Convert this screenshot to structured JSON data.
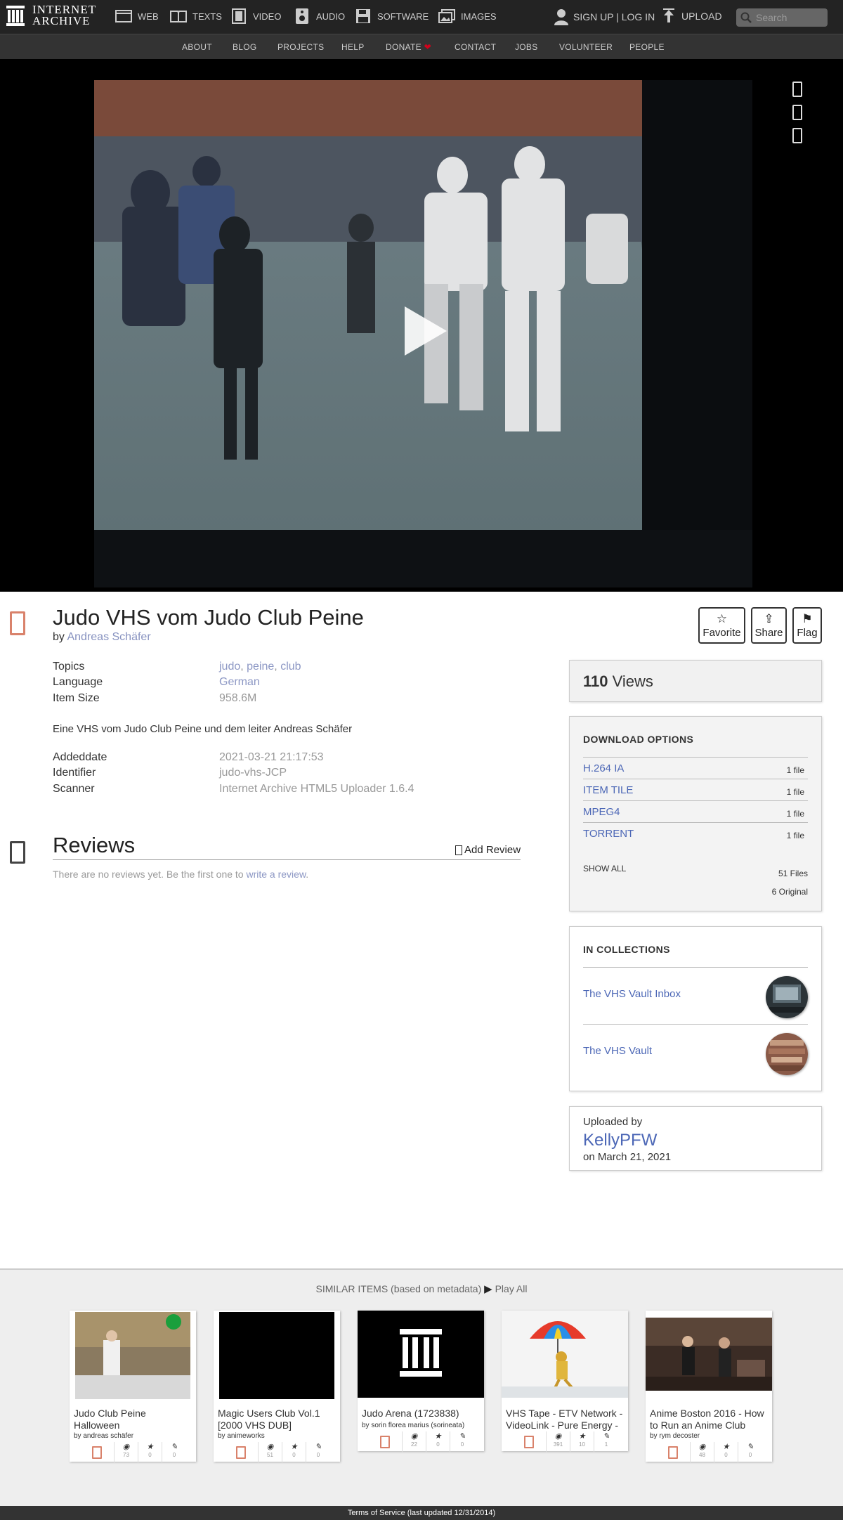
{
  "topnav": {
    "logo_line1": "INTERNET",
    "logo_line2": "ARCHIVE",
    "media": [
      {
        "label": "WEB",
        "icon": "web-icon"
      },
      {
        "label": "TEXTS",
        "icon": "book-icon"
      },
      {
        "label": "VIDEO",
        "icon": "film-icon"
      },
      {
        "label": "AUDIO",
        "icon": "speaker-icon"
      },
      {
        "label": "SOFTWARE",
        "icon": "floppy-icon"
      },
      {
        "label": "IMAGES",
        "icon": "image-icon"
      }
    ],
    "signup": "SIGN UP | LOG IN",
    "upload": "UPLOAD",
    "search_placeholder": "Search"
  },
  "subnav": [
    "ABOUT",
    "BLOG",
    "PROJECTS",
    "HELP",
    "DONATE",
    "CONTACT",
    "JOBS",
    "VOLUNTEER",
    "PEOPLE"
  ],
  "colors": {
    "accent_link": "#4c67b6",
    "muted_link": "#8c97c4",
    "donate_heart": "#d0021b",
    "item_icon": "#d9826b"
  },
  "item": {
    "title": "Judo VHS vom Judo Club Peine",
    "by_label": "by",
    "creator": "Andreas Schäfer",
    "actions": [
      {
        "label": "Favorite",
        "icon": "☆"
      },
      {
        "label": "Share",
        "icon": "⇪"
      },
      {
        "label": "Flag",
        "icon": "⚑"
      }
    ],
    "meta": {
      "topics_label": "Topics",
      "topics": [
        "judo",
        "peine",
        "club"
      ],
      "language_label": "Language",
      "language": "German",
      "size_label": "Item Size",
      "size": "958.6M",
      "description": "Eine VHS vom Judo Club Peine und dem leiter Andreas Schäfer",
      "added_label": "Addeddate",
      "added": "2021-03-21 21:17:53",
      "identifier_label": "Identifier",
      "identifier": "judo-vhs-JCP",
      "scanner_label": "Scanner",
      "scanner": "Internet Archive HTML5 Uploader 1.6.4"
    }
  },
  "reviews": {
    "title": "Reviews",
    "add_label": "Add Review",
    "empty_text": "There are no reviews yet. Be the first one to",
    "write_link": "write a review",
    "period": "."
  },
  "stats": {
    "views": "110",
    "views_label": "Views"
  },
  "downloads": {
    "heading": "DOWNLOAD OPTIONS",
    "options": [
      {
        "name": "H.264 IA",
        "count": "1 file"
      },
      {
        "name": "ITEM TILE",
        "count": "1 file"
      },
      {
        "name": "MPEG4",
        "count": "1 file"
      },
      {
        "name": "TORRENT",
        "count": "1 file"
      }
    ],
    "show_all": "SHOW ALL",
    "files": "51 Files",
    "original": "6 Original"
  },
  "collections": {
    "heading": "IN COLLECTIONS",
    "items": [
      {
        "name": "The VHS Vault Inbox"
      },
      {
        "name": "The VHS Vault"
      }
    ]
  },
  "uploader": {
    "label": "Uploaded by",
    "name": "KellyPFW",
    "date": "on March 21, 2021"
  },
  "similar": {
    "heading": "SIMILAR ITEMS (based on metadata)",
    "play_all": "Play All",
    "items": [
      {
        "title": "Judo Club Peine Halloween",
        "by": "by andreas schäfer",
        "views": "73",
        "favs": "0",
        "reviews": "0"
      },
      {
        "title": "Magic Users Club Vol.1 [2000 VHS DUB]",
        "by": "by animeworks",
        "views": "51",
        "favs": "0",
        "reviews": "0"
      },
      {
        "title": "Judo Arena (1723838)",
        "by": "by sorin florea marius (sorineata)",
        "views": "22",
        "favs": "0",
        "reviews": "0"
      },
      {
        "title": "VHS Tape - ETV Network - VideoLink - Pure Energy -",
        "by": "",
        "views": "391",
        "favs": "10",
        "reviews": "1"
      },
      {
        "title": "Anime Boston 2016 - How to Run an Anime Club",
        "by": "by rym decoster",
        "views": "48",
        "favs": "0",
        "reviews": "0"
      }
    ]
  },
  "footer": "Terms of Service (last updated 12/31/2014)"
}
